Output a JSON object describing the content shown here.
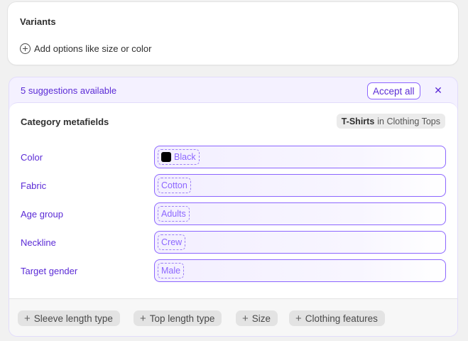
{
  "variants": {
    "title": "Variants",
    "add_options_label": "Add options like size or color"
  },
  "suggestions": {
    "count_label": "5 suggestions available",
    "accept_all_label": "Accept all",
    "close_glyph": "✕"
  },
  "metafields": {
    "title": "Category metafields",
    "category": {
      "name": "T-Shirts",
      "suffix": "in Clothing Tops"
    },
    "fields": [
      {
        "label": "Color",
        "value": "Black",
        "swatch": "#000000"
      },
      {
        "label": "Fabric",
        "value": "Cotton"
      },
      {
        "label": "Age group",
        "value": "Adults"
      },
      {
        "label": "Neckline",
        "value": "Crew"
      },
      {
        "label": "Target gender",
        "value": "Male"
      }
    ]
  },
  "add_fields": [
    {
      "label": "Sleeve length type"
    },
    {
      "label": "Top length type"
    },
    {
      "label": "Size"
    },
    {
      "label": "Clothing features"
    }
  ],
  "colors": {
    "accent": "#5b2bd6",
    "accent_border": "#8c66ff",
    "suggest_bg": "#f4f1ff"
  }
}
